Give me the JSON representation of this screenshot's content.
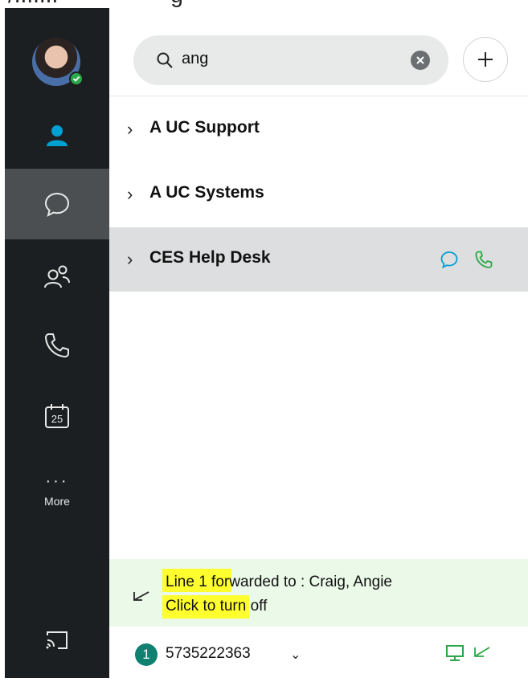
{
  "search": {
    "value": "ang"
  },
  "sidebar": {
    "more_label": "More",
    "calendar_day": "25"
  },
  "contacts": [
    {
      "name": "A UC Support"
    },
    {
      "name": "A UC Systems"
    },
    {
      "name": "CES Help Desk"
    }
  ],
  "forwarding": {
    "line_text": "Line 1 forwarded to  : Craig, Angie",
    "action_text": "Click to turn off"
  },
  "status_bar": {
    "line_number": "1",
    "phone_number": "5735222363"
  },
  "colors": {
    "accent": "#00a0d1",
    "call_green": "#2aa84a",
    "forward_bg": "#ebf9e8",
    "highlight": "#ffff2e"
  }
}
